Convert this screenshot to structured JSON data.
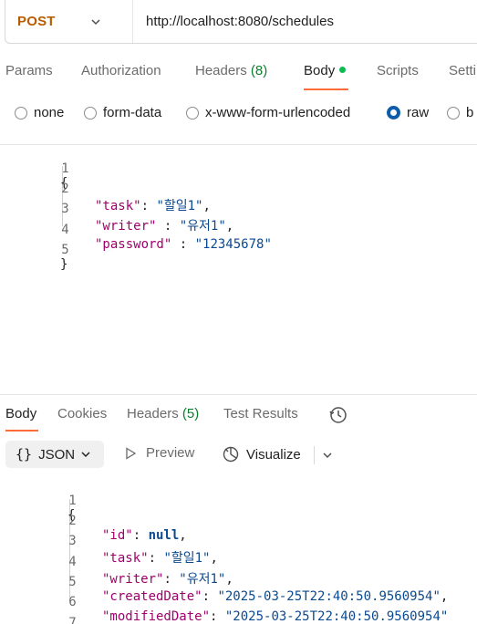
{
  "request": {
    "method": "POST",
    "url": "http://localhost:8080/schedules",
    "tabs": [
      {
        "label": "Params"
      },
      {
        "label": "Authorization"
      },
      {
        "label": "Headers",
        "count": "(8)"
      },
      {
        "label": "Body"
      },
      {
        "label": "Scripts"
      },
      {
        "label": "Setti"
      }
    ],
    "body_types": [
      "none",
      "form-data",
      "x-www-form-urlencoded",
      "raw",
      "b"
    ],
    "selected_body_type": "raw",
    "line_numbers": [
      "1",
      "2",
      "3",
      "4",
      "5"
    ],
    "body_lines": {
      "open": "{",
      "task_key": "\"task\"",
      "task_sep": ": ",
      "task_val": "\"할일1\"",
      "task_end": ",",
      "writer_key": "\"writer\"",
      "writer_sep": " : ",
      "writer_val": "\"유저1\"",
      "writer_end": ",",
      "password_key": "\"password\"",
      "password_sep": " : ",
      "password_val": "\"12345678\"",
      "close": "}"
    }
  },
  "response": {
    "tabs": [
      {
        "label": "Body"
      },
      {
        "label": "Cookies"
      },
      {
        "label": "Headers",
        "count": "(5)"
      },
      {
        "label": "Test Results"
      }
    ],
    "format_label": "JSON",
    "format_icon": "{}",
    "preview_label": "Preview",
    "visualize_label": "Visualize",
    "line_numbers": [
      "1",
      "2",
      "3",
      "4",
      "5",
      "6",
      "7"
    ],
    "body_lines": {
      "open": "{",
      "id_key": "\"id\"",
      "id_sep": ": ",
      "id_val": "null",
      "id_end": ",",
      "task_key": "\"task\"",
      "task_sep": ": ",
      "task_val": "\"할일1\"",
      "task_end": ",",
      "writer_key": "\"writer\"",
      "writer_sep": ": ",
      "writer_val": "\"유저1\"",
      "writer_end": ",",
      "created_key": "\"createdDate\"",
      "created_sep": ": ",
      "created_val": "\"2025-03-25T22:40:50.9560954\"",
      "created_end": ",",
      "modified_key": "\"modifiedDate\"",
      "modified_sep": ": ",
      "modified_val": "\"2025-03-25T22:40:50.9560954\"",
      "close": "}"
    }
  },
  "colors": {
    "accent": "#ff6c37",
    "method": "#b85c00",
    "radio_selected": "#0b5cad",
    "status_dot": "#0cbb52",
    "count": "#0a7d2c"
  }
}
